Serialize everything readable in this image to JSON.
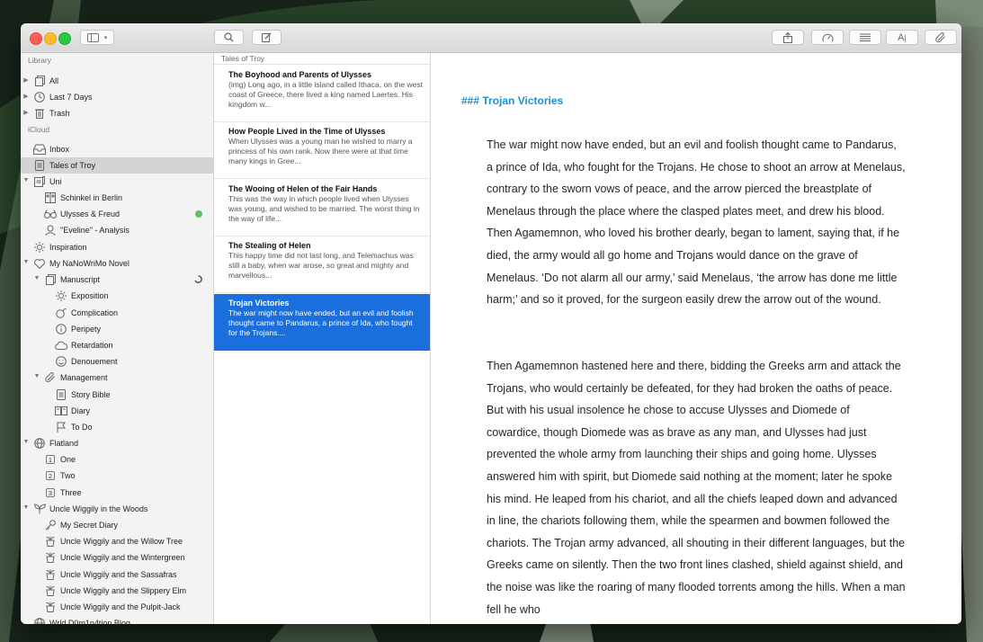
{
  "sidebar": {
    "sections": {
      "library": "Library",
      "icloud": "iCloud"
    },
    "items": [
      {
        "label": "All",
        "icon": "stack-icon"
      },
      {
        "label": "Last 7 Days",
        "icon": "clock-icon"
      },
      {
        "label": "Trash",
        "icon": "trash-icon"
      },
      {
        "label": "Inbox",
        "icon": "inbox-icon"
      },
      {
        "label": "Tales of Troy",
        "icon": "document-icon"
      },
      {
        "label": "Uni",
        "icon": "folder-icon"
      },
      {
        "label": "Schinkel in Berlin",
        "icon": "building-icon"
      },
      {
        "label": "Ulysses & Freud",
        "icon": "glasses-icon"
      },
      {
        "label": "\"Eveline\" - Analysis",
        "icon": "person-icon"
      },
      {
        "label": "Inspiration",
        "icon": "sparkle-icon"
      },
      {
        "label": "My NaNoWriMo Novel",
        "icon": "heart-icon"
      },
      {
        "label": "Manuscript",
        "icon": "stack-icon"
      },
      {
        "label": "Exposition",
        "icon": "sparkle-icon"
      },
      {
        "label": "Complication",
        "icon": "bomb-icon"
      },
      {
        "label": "Peripety",
        "icon": "info-icon"
      },
      {
        "label": "Retardation",
        "icon": "cloud-icon"
      },
      {
        "label": "Denouement",
        "icon": "smile-icon"
      },
      {
        "label": "Management",
        "icon": "paperclip-icon"
      },
      {
        "label": "Story Bible",
        "icon": "document-icon"
      },
      {
        "label": "Diary",
        "icon": "book-icon"
      },
      {
        "label": "To Do",
        "icon": "flag-icon"
      },
      {
        "label": "Flatland",
        "icon": "globe-icon"
      },
      {
        "label": "One",
        "icon": "number-icon",
        "number": "1"
      },
      {
        "label": "Two",
        "icon": "number-icon",
        "number": "2"
      },
      {
        "label": "Three",
        "icon": "number-icon",
        "number": "3"
      },
      {
        "label": "Uncle Wiggily in the Woods",
        "icon": "leaf-icon"
      },
      {
        "label": "My Secret Diary",
        "icon": "key-icon"
      },
      {
        "label": "Uncle Wiggily and the Willow Tree",
        "icon": "plant-icon"
      },
      {
        "label": "Uncle Wiggily and the Wintergreen",
        "icon": "plant-icon"
      },
      {
        "label": "Uncle Wiggily and the Sassafras",
        "icon": "plant-icon"
      },
      {
        "label": "Uncle Wiggily and the Slippery Elm",
        "icon": "plant-icon"
      },
      {
        "label": "Uncle Wiggily and the Pulpit-Jack",
        "icon": "plant-icon"
      },
      {
        "label": "Wrld D0m1n4tion Blog",
        "icon": "globe-icon"
      }
    ]
  },
  "sheet_list": {
    "title": "Tales of Troy",
    "sheets": [
      {
        "title": "The Boyhood and Parents of Ulysses",
        "preview": "(img) Long ago, in a little island called Ithaca, on the west coast of Greece, there lived a king named Laertes. His kingdom w..."
      },
      {
        "title": "How People Lived in the Time of Ulysses",
        "preview": "When Ulysses was a young man he wished to marry a princess of his own rank. Now there were at that time many kings in Gree..."
      },
      {
        "title": "The Wooing of Helen of the Fair Hands",
        "preview": "This was the way in which people lived when Ulysses was young, and wished to be married. The worst thing in the way of life..."
      },
      {
        "title": "The Stealing of Helen",
        "preview": "This happy time did not last long, and Telemachus was still a baby, when war arose, so great and mighty and marvellous..."
      },
      {
        "title": "Trojan Victories",
        "preview": "The war might now have ended, but an evil and foolish thought came to Pandarus, a prince of Ida, who fought for the Trojans...."
      }
    ]
  },
  "editor": {
    "heading": "### Trojan Victories",
    "paragraphs": [
      "The war might now have ended, but an evil and foolish thought came to Pandarus, a prince of Ida, who fought for the Trojans. He chose to shoot an arrow at Menelaus, contrary to the sworn vows of peace, and the arrow pierced the breastplate of Menelaus through the place where the clasped plates meet, and drew his blood. Then Agamemnon, who loved his brother dearly, began to lament, saying that, if he died, the army would all go home and Trojans would dance on the grave of Menelaus. ‘Do not alarm all our army,’ said Menelaus, ‘the arrow has done me little harm;’ and so it proved, for the surgeon easily drew the arrow out of the wound.",
      "Then Agamemnon hastened here and there, bidding the Greeks arm and attack the Trojans, who would certainly be defeated, for they had broken the oaths of peace. But with his usual insolence he chose to accuse Ulysses and Diomede of cowardice, though Diomede was as brave as any man, and Ulysses had just prevented the whole army from launching their ships and going home. Ulysses answered him with spirit, but Diomede said nothing at the moment; later he spoke his mind. He leaped from his chariot, and all the chiefs leaped down and advanced in line, the chariots following them, while the spearmen and bowmen followed the chariots. The Trojan army advanced, all shouting in their different languages, but the Greeks came on silently. Then the two front lines clashed, shield against shield, and the noise was like the roaring of many flooded torrents among the hills. When a man fell he who"
    ]
  },
  "colors": {
    "accent": "#1b6fdc",
    "heading": "#1e8fd0",
    "goal_dot": "#5fbe68"
  }
}
